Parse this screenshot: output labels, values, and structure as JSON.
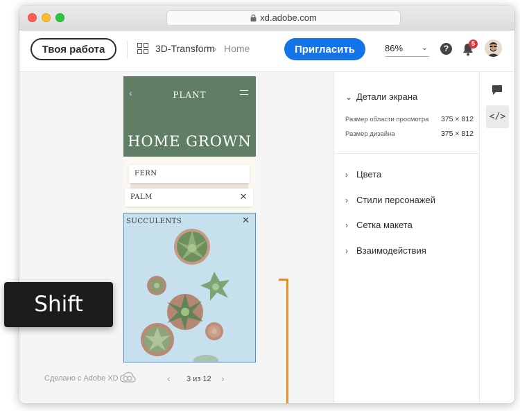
{
  "browser": {
    "url": "xd.adobe.com"
  },
  "appbar": {
    "work_button": "Твоя работа",
    "project": "3D-Transform",
    "breadcrumb_sep": "›",
    "page": "Home",
    "invite_button": "Пригласить",
    "zoom": "86%",
    "help": "?",
    "notifications": "5"
  },
  "artboard": {
    "logo": "PLANT",
    "hero_title": "HOME GROWN",
    "cards": [
      {
        "label": "FERN"
      },
      {
        "label": "PALM"
      },
      {
        "label": "SUCCULENTS"
      }
    ],
    "close": "✕",
    "back": "‹"
  },
  "footer": {
    "made_with": "Сделано с Adobe XD",
    "pager": "3 из 12",
    "prev": "‹",
    "next": "›"
  },
  "panel": {
    "screen_details": "Детали экрана",
    "viewport_label": "Размер области просмотра",
    "viewport_value": "375 × 812",
    "design_label": "Размер дизайна",
    "design_value": "375 × 812",
    "sections": [
      "Цвета",
      "Стили персонажей",
      "Сетка макета",
      "Взаимодействия"
    ]
  },
  "rail": {
    "code": "</>"
  },
  "key_overlay": "Shift",
  "colors": {
    "accent_blue": "#1473e6",
    "hero_green": "#5f7e63",
    "bracket_orange": "#e98b1e",
    "selection_blue": "#4a90d4",
    "badge_red": "#d7373f"
  }
}
